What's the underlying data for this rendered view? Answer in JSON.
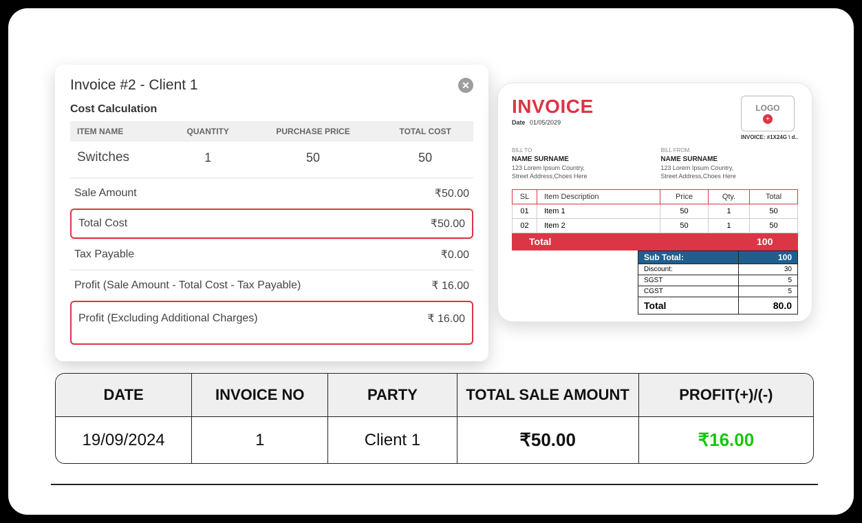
{
  "cost_panel": {
    "title": "Invoice #2 - Client 1",
    "section_label": "Cost Calculation",
    "headers": {
      "item": "ITEM NAME",
      "qty": "QUANTITY",
      "price": "PURCHASE PRICE",
      "total": "TOTAL COST"
    },
    "item": {
      "name": "Switches",
      "qty": "1",
      "price": "50",
      "total": "50"
    },
    "rows": {
      "sale_label": "Sale Amount",
      "sale_val": "₹50.00",
      "cost_label": "Total Cost",
      "cost_val": "₹50.00",
      "tax_label": "Tax Payable",
      "tax_val": "₹0.00",
      "profit1_label": "Profit (Sale Amount - Total Cost - Tax Payable)",
      "profit1_val": "₹ 16.00",
      "profit2_label": "Profit (Excluding Additional Charges)",
      "profit2_val": "₹ 16.00"
    }
  },
  "invoice_preview": {
    "heading": "INVOICE",
    "logo_text": "LOGO",
    "date_label": "Date",
    "date_value": "01/05/2029",
    "invoice_no_label": "INVOICE: #1X24G \\ d..",
    "bill_to_label": "BILL TO",
    "bill_from_label": "BILL FROM",
    "party_name": "NAME SURNAME",
    "addr1": "123  Lorem Ipsum Country,",
    "addr2": "Street Address,Choes Here",
    "columns": {
      "sl": "SL",
      "desc": "Item Description",
      "price": "Price",
      "qty": "Qty.",
      "total": "Total"
    },
    "items": [
      {
        "sl": "01",
        "desc": "Item 1",
        "price": "50",
        "qty": "1",
        "total": "50"
      },
      {
        "sl": "02",
        "desc": "Item 2",
        "price": "50",
        "qty": "1",
        "total": "50"
      }
    ],
    "total_label": "Total",
    "total_value": "100",
    "subtotal_label": "Sub Total:",
    "subtotal_value": "100",
    "discount_label": "Discount:",
    "discount_value": "30",
    "sgst_label": "SGST",
    "sgst_value": "5",
    "cgst_label": "CGST",
    "cgst_value": "5",
    "final_label": "Total",
    "final_value": "80.0"
  },
  "summary": {
    "headers": {
      "date": "DATE",
      "inv": "INVOICE NO",
      "party": "PARTY",
      "amount": "TOTAL SALE AMOUNT",
      "profit": "PROFIT(+)/(-)"
    },
    "row": {
      "date": "19/09/2024",
      "inv": "1",
      "party": "Client 1",
      "amount": "₹50.00",
      "profit": "₹16.00"
    }
  }
}
